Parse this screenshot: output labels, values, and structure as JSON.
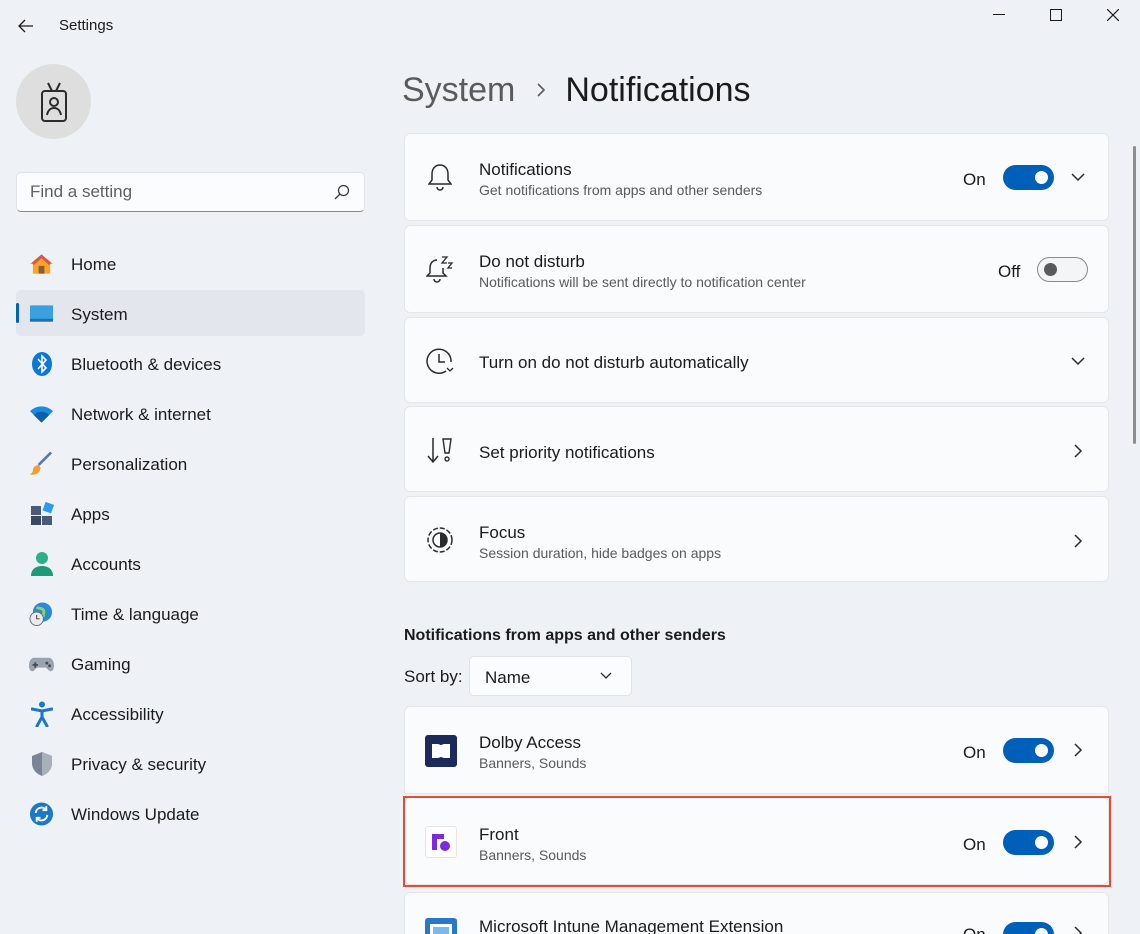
{
  "window": {
    "title": "Settings",
    "back_icon": "back-arrow-icon",
    "minimize_icon": "minimize-icon",
    "maximize_icon": "maximize-icon",
    "close_icon": "close-icon"
  },
  "sidebar": {
    "search": {
      "placeholder": "Find a setting",
      "value": ""
    },
    "items": [
      {
        "label": "Home",
        "icon": "home-icon",
        "active": false
      },
      {
        "label": "System",
        "icon": "system-icon",
        "active": true
      },
      {
        "label": "Bluetooth & devices",
        "icon": "bluetooth-icon",
        "active": false
      },
      {
        "label": "Network & internet",
        "icon": "wifi-icon",
        "active": false
      },
      {
        "label": "Personalization",
        "icon": "brush-icon",
        "active": false
      },
      {
        "label": "Apps",
        "icon": "apps-icon",
        "active": false
      },
      {
        "label": "Accounts",
        "icon": "accounts-icon",
        "active": false
      },
      {
        "label": "Time & language",
        "icon": "globe-clock-icon",
        "active": false
      },
      {
        "label": "Gaming",
        "icon": "gamepad-icon",
        "active": false
      },
      {
        "label": "Accessibility",
        "icon": "accessibility-icon",
        "active": false
      },
      {
        "label": "Privacy & security",
        "icon": "shield-icon",
        "active": false
      },
      {
        "label": "Windows Update",
        "icon": "update-icon",
        "active": false
      }
    ]
  },
  "breadcrumb": {
    "parent": "System",
    "current": "Notifications"
  },
  "settings": [
    {
      "title": "Notifications",
      "subtitle": "Get notifications from apps and other senders",
      "state": "On",
      "icon": "bell-icon"
    },
    {
      "title": "Do not disturb",
      "subtitle": "Notifications will be sent directly to notification center",
      "state": "Off",
      "icon": "bell-snooze-icon"
    },
    {
      "title": "Turn on do not disturb automatically",
      "icon": "clock-icon"
    },
    {
      "title": "Set priority notifications",
      "icon": "priority-icon"
    },
    {
      "title": "Focus",
      "subtitle": "Session duration, hide badges on apps",
      "icon": "focus-icon"
    }
  ],
  "apps_section": {
    "title": "Notifications from apps and other senders",
    "sort_label": "Sort by:",
    "sort_value": "Name",
    "apps": [
      {
        "name": "Dolby Access",
        "detail": "Banners, Sounds",
        "state": "On",
        "icon": "dolby-access-icon"
      },
      {
        "name": "Front",
        "detail": "Banners, Sounds",
        "state": "On",
        "icon": "front-app-icon"
      },
      {
        "name": "Microsoft Intune Management Extension",
        "state": "On",
        "icon": "intune-icon"
      }
    ]
  },
  "colors": {
    "accent": "#005fb8",
    "highlight": "#e84a2f",
    "background": "#eef2f7"
  }
}
